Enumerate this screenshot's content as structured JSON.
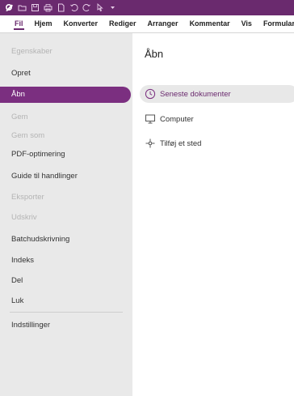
{
  "quick_access": {
    "icons": [
      "app-logo-icon",
      "open-folder-icon",
      "save-icon",
      "print-icon",
      "new-document-icon",
      "undo-icon",
      "redo-icon",
      "cursor-icon",
      "customize-dropdown-icon"
    ]
  },
  "menu": {
    "items": [
      "Fil",
      "Hjem",
      "Konverter",
      "Rediger",
      "Arranger",
      "Kommentar",
      "Vis",
      "Formular"
    ],
    "active": "Fil"
  },
  "sidebar": {
    "items": [
      {
        "label": "Egenskaber",
        "disabled": true
      },
      {
        "label": "Opret",
        "disabled": false
      },
      {
        "label": "Åbn",
        "disabled": false,
        "active": true
      },
      {
        "label": "Gem",
        "disabled": true
      },
      {
        "label": "Gem som",
        "disabled": true
      },
      {
        "label": "PDF-optimering",
        "disabled": false
      },
      {
        "label": "Guide til handlinger",
        "disabled": false
      },
      {
        "label": "Eksporter",
        "disabled": true
      },
      {
        "label": "Udskriv",
        "disabled": true
      },
      {
        "label": "Batchudskrivning",
        "disabled": false
      },
      {
        "label": "Indeks",
        "disabled": false
      },
      {
        "label": "Del",
        "disabled": false
      },
      {
        "label": "Luk",
        "disabled": false
      },
      {
        "label": "Indstillinger",
        "disabled": false
      }
    ]
  },
  "content": {
    "title": "Åbn",
    "options": [
      {
        "label": "Seneste dokumenter",
        "icon": "clock-icon",
        "selected": true
      },
      {
        "label": "Computer",
        "icon": "computer-icon",
        "selected": false
      },
      {
        "label": "Tilføj et sted",
        "icon": "add-place-icon",
        "selected": false
      }
    ]
  },
  "colors": {
    "accent": "#7b2f80",
    "titlebar": "#6a2a6e",
    "sidebar_bg": "#e9e9e9",
    "disabled_text": "#b4b4b4"
  }
}
